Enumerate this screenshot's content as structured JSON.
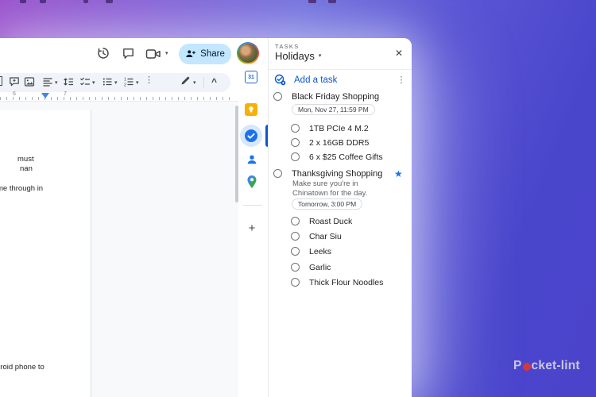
{
  "window_chrome": {
    "share_label": "Share"
  },
  "ruler": {
    "numbers": [
      "6",
      "7"
    ]
  },
  "document": {
    "fragments": [
      "must",
      "nan",
      "me through in",
      "droid phone to"
    ]
  },
  "tasks_panel": {
    "header_label": "TASKS",
    "list_name": "Holidays",
    "add_task_label": "Add a task",
    "tasks": [
      {
        "title": "Black Friday Shopping",
        "due": "Mon, Nov 27, 11:59 PM",
        "starred": false,
        "subtasks": [
          "1TB PCIe 4 M.2",
          "2 x 16GB DDR5",
          "6 x $25 Coffee Gifts"
        ]
      },
      {
        "title": "Thanksgiving Shopping",
        "description": "Make sure you're in Chinatown for the day.",
        "due": "Tomorrow, 3:00 PM",
        "starred": true,
        "subtasks": [
          "Roast Duck",
          "Char Siu",
          "Leeks",
          "Garlic",
          "Thick Flour Noodles"
        ]
      }
    ]
  },
  "icons": {
    "close": "✕",
    "kebab": "⋮",
    "caret_down": "▾",
    "star": "★",
    "plus": "+",
    "chevron_up": "^",
    "calendar_day": "31"
  },
  "brand": {
    "logo_left": "P",
    "logo_right": "cket-lint"
  },
  "colors": {
    "accent_blue": "#0b57d0",
    "share_pill": "#c2e7ff",
    "active_pill": "#d9e7fd",
    "chip_border": "#dadce0",
    "logo_red": "#d5373c",
    "bg_purple": "#9c55cd",
    "bg_blue": "#4b44cb"
  }
}
